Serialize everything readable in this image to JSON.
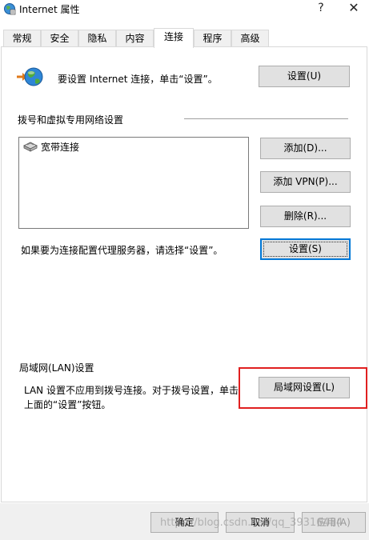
{
  "window": {
    "title": "Internet 属性",
    "help_glyph": "?",
    "close_glyph": "✕",
    "icon": "internet-options-icon"
  },
  "tabs": [
    {
      "label": "常规"
    },
    {
      "label": "安全"
    },
    {
      "label": "隐私"
    },
    {
      "label": "内容"
    },
    {
      "label": "连接",
      "active": true
    },
    {
      "label": "程序"
    },
    {
      "label": "高级"
    }
  ],
  "connection_setup": {
    "text": "要设置 Internet 连接，单击“设置”。",
    "button": "设置(U)",
    "icon": "globe-icon"
  },
  "dialup_vpn": {
    "heading": "拨号和虚拟专用网络设置",
    "items": [
      {
        "label": "宽带连接",
        "icon": "network-connection-icon"
      }
    ],
    "add_button": "添加(D)...",
    "add_vpn_button": "添加 VPN(P)...",
    "delete_button": "删除(R)...",
    "proxy_text": "如果要为连接配置代理服务器，请选择“设置”。",
    "settings_button": "设置(S)"
  },
  "lan": {
    "heading": "局域网(LAN)设置",
    "text_line1": "LAN 设置不应用到拨号连接。对于拨号设置，单击",
    "text_line2": "上面的“设置”按钮。",
    "button": "局域网设置(L)"
  },
  "footer": {
    "ok_button": "确定",
    "cancel_button": "取消",
    "apply_button": "应用(A)"
  },
  "watermark": "https://blog.csdn.net/qq_39316434",
  "colors": {
    "highlight": "#e02020",
    "default_button_border": "#0078d7"
  }
}
